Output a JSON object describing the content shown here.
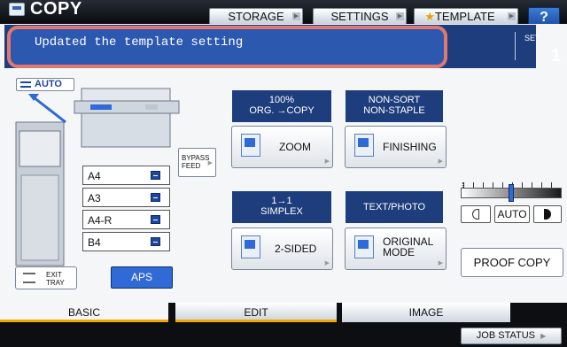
{
  "header": {
    "title": "COPY",
    "buttons": [
      "STORAGE",
      "SETTINGS",
      "TEMPLATE",
      "?"
    ]
  },
  "message": "Updated the template setting",
  "set": {
    "label": "SET",
    "value": "1"
  },
  "auto_button": "AUTO",
  "paper_trays": [
    "A4",
    "A3",
    "A4-R",
    "B4"
  ],
  "bypass": {
    "line1": "BYPASS",
    "line2": "FEED"
  },
  "exit_tray": {
    "line1": "EXIT",
    "line2": "TRAY"
  },
  "aps": "APS",
  "zoom": {
    "header1": "100%",
    "header2": "ORG. →COPY",
    "label": "ZOOM"
  },
  "finishing": {
    "header1": "NON-SORT",
    "header2": "NON-STAPLE",
    "label": "FINISHING"
  },
  "duplex": {
    "header1": "1→1",
    "header2": "SIMPLEX",
    "label": "2-SIDED"
  },
  "original": {
    "header": "TEXT/PHOTO",
    "label1": "ORIGINAL",
    "label2": "MODE"
  },
  "density": {
    "auto": "AUTO",
    "level": 0.5
  },
  "proof_copy": "PROOF COPY",
  "tabs": {
    "basic": "BASIC",
    "edit": "EDIT",
    "image": "IMAGE"
  },
  "job_status": "JOB STATUS",
  "colors": {
    "accent": "#2f6ad6",
    "header_blue": "#1e3d7d",
    "highlight": "#e0786f",
    "tab_underline": "#f0a800"
  }
}
